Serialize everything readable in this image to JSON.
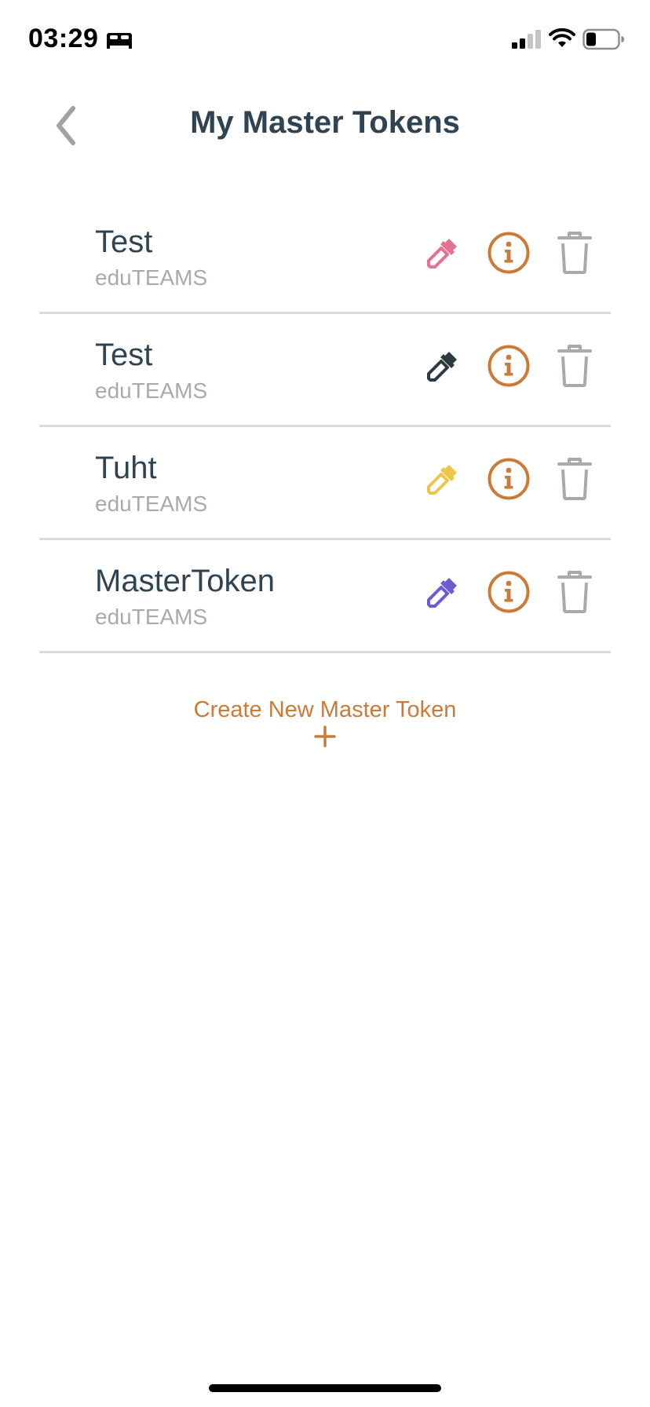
{
  "status_bar": {
    "time": "03:29",
    "icons": [
      "sleep-mode-icon",
      "cellular-signal-icon",
      "wifi-icon",
      "battery-icon"
    ]
  },
  "header": {
    "title": "My Master Tokens",
    "back_icon": "chevron-left-icon"
  },
  "colors": {
    "title_text": "#2f4352",
    "secondary_text": "#a7abb0",
    "accent": "#c97c39",
    "trash": "#a7abb0",
    "divider": "#dcdcdc"
  },
  "tokens": [
    {
      "name": "Test",
      "issuer": "eduTEAMS",
      "color": "#e5708f"
    },
    {
      "name": "Test",
      "issuer": "eduTEAMS",
      "color": "#2f3a40"
    },
    {
      "name": "Tuht",
      "issuer": "eduTEAMS",
      "color": "#ecc64b"
    },
    {
      "name": "MasterToken",
      "issuer": "eduTEAMS",
      "color": "#6c5bd1"
    }
  ],
  "create_button": {
    "label": "Create New Master Token",
    "icon": "plus-icon"
  }
}
